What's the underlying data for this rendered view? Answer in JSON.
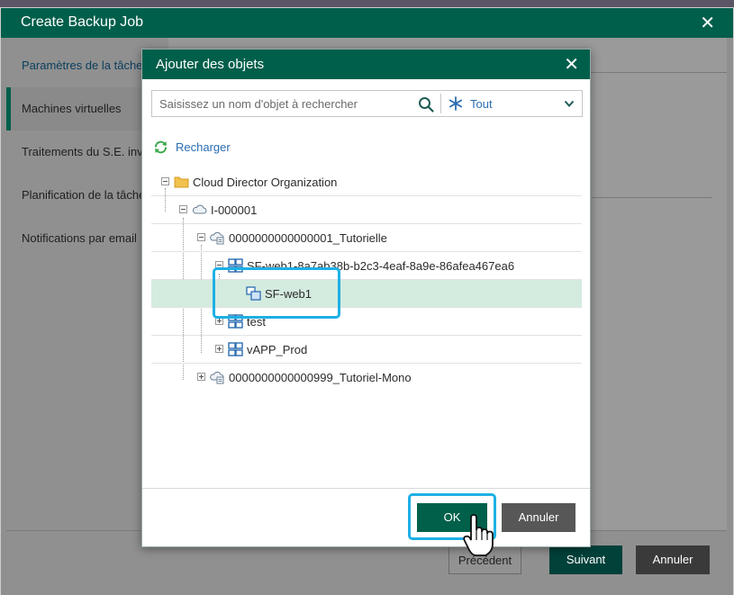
{
  "wizard": {
    "title": "Create Backup Job",
    "sidebar": [
      {
        "label": "Paramètres de la tâche"
      },
      {
        "label": "Machines virtuelles"
      },
      {
        "label": "Traitements du S.E. invité"
      },
      {
        "label": "Planification de la tâche"
      },
      {
        "label": "Notifications par email"
      }
    ],
    "footer": {
      "prev": "Précédent",
      "next": "Suivant",
      "cancel": "Annuler"
    }
  },
  "dialog": {
    "title": "Ajouter des objets",
    "search": {
      "placeholder": "Saisissez un nom d'objet à rechercher"
    },
    "filter": {
      "selected": "Tout"
    },
    "reload": "Recharger",
    "tree": [
      {
        "label": "Cloud Director Organization",
        "icon": "folder-icon"
      },
      {
        "label": "I-000001",
        "icon": "cloud-icon"
      },
      {
        "label": "0000000000000001_Tutorielle",
        "icon": "vdc-icon"
      },
      {
        "label": "SF-web1-8a7ab38b-b2c3-4eaf-8a9e-86afea467ea6",
        "icon": "vapp-icon"
      },
      {
        "label": "SF-web1",
        "icon": "vm-icon",
        "selected": true
      },
      {
        "label": "test",
        "icon": "vapp-icon"
      },
      {
        "label": "vAPP_Prod",
        "icon": "vapp-icon"
      },
      {
        "label": "0000000000000999_Tutoriel-Mono",
        "icon": "vdc-icon"
      }
    ],
    "ok": "OK",
    "cancel": "Annuler"
  },
  "colors": {
    "brand": "#005f4b",
    "link": "#2a6db0",
    "highlight": "#1eb0e5",
    "selected_row": "#d4ebe0"
  }
}
